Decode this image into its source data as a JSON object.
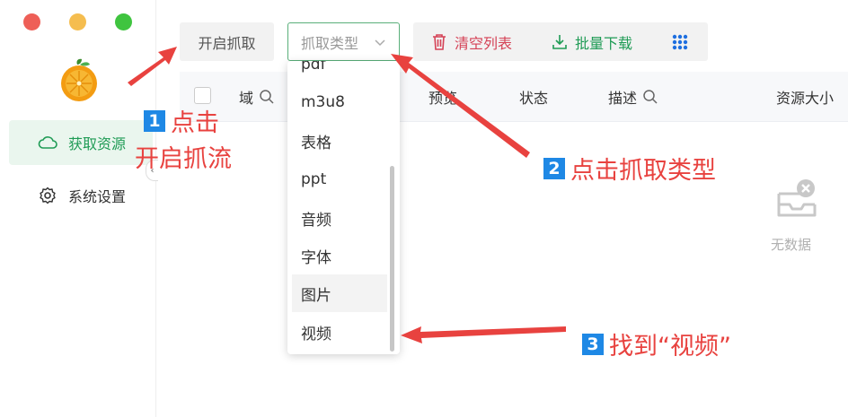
{
  "sidebar": {
    "items": [
      {
        "label": "获取资源",
        "icon": "cloud-icon"
      },
      {
        "label": "系统设置",
        "icon": "gear-icon"
      }
    ]
  },
  "toolbar": {
    "start_capture": "开启抓取",
    "type_select_placeholder": "抓取类型",
    "clear_list": "清空列表",
    "batch_download": "批量下载"
  },
  "table": {
    "columns": [
      "域",
      "预览",
      "状态",
      "描述",
      "资源大小"
    ]
  },
  "empty_state": {
    "label": "无数据"
  },
  "dropdown": {
    "options": [
      "pdf",
      "m3u8",
      "表格",
      "ppt",
      "音频",
      "字体",
      "图片",
      "视频"
    ],
    "hovered": "图片"
  },
  "annotations": {
    "step1_badge": "1",
    "step1_line1": "点击",
    "step1_line2": "开启抓流",
    "step2_badge": "2",
    "step2_text": "点击抓取类型",
    "step3_badge": "3",
    "step3_text": "找到“视频”"
  },
  "colors": {
    "accent_green": "#1f9b55",
    "danger_red": "#d54256",
    "annotation_red": "#e8423f",
    "badge_blue": "#1e88e5"
  }
}
